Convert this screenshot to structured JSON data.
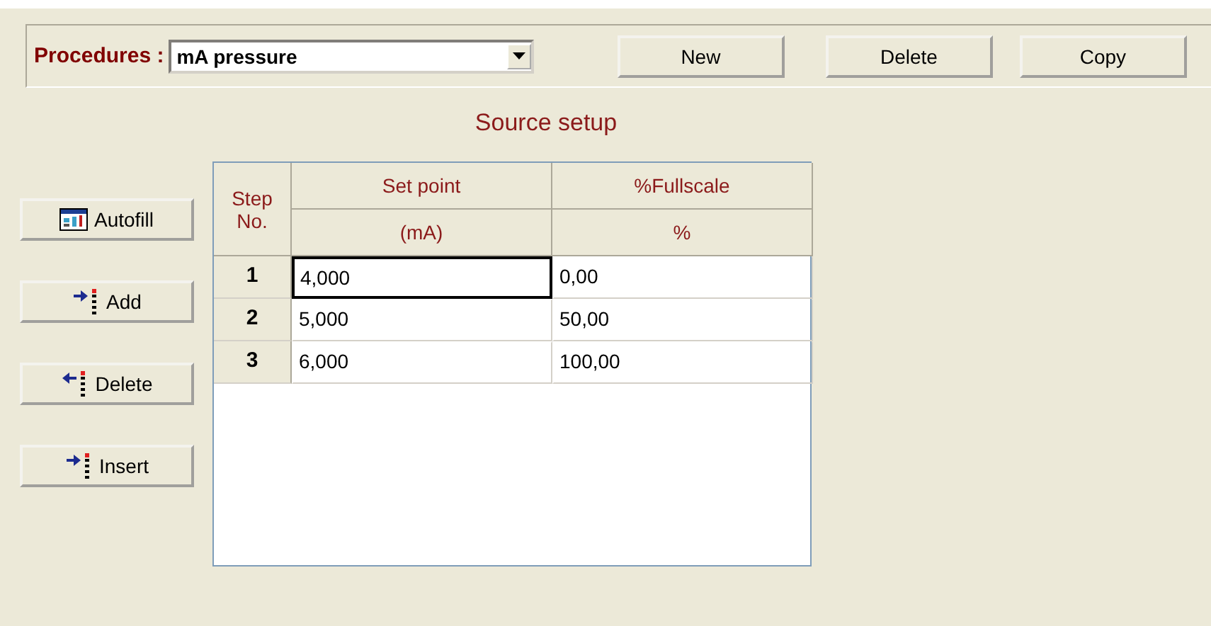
{
  "procedures": {
    "label": "Procedures :",
    "value": "mA pressure"
  },
  "top_buttons": [
    "New",
    "Delete",
    "Copy"
  ],
  "section_title": "Source setup",
  "side_buttons": [
    {
      "kind": "autofill",
      "label": "Autofill"
    },
    {
      "kind": "add",
      "label": "Add"
    },
    {
      "kind": "delete",
      "label": "Delete"
    },
    {
      "kind": "insert",
      "label": "Insert"
    }
  ],
  "table": {
    "step_header": "Step No.",
    "columns": [
      {
        "name": "Set point",
        "unit": "(mA)"
      },
      {
        "name": "%Fullscale",
        "unit": "%"
      }
    ],
    "rows": [
      {
        "step": "1",
        "cells": [
          {
            "value": "4,000",
            "focused": true
          },
          {
            "value": "0,00",
            "focused": false
          }
        ]
      },
      {
        "step": "2",
        "cells": [
          {
            "value": "5,000",
            "focused": false
          },
          {
            "value": "50,00",
            "focused": false
          }
        ]
      },
      {
        "step": "3",
        "cells": [
          {
            "value": "6,000",
            "focused": false
          },
          {
            "value": "100,00",
            "focused": false
          }
        ]
      }
    ]
  }
}
